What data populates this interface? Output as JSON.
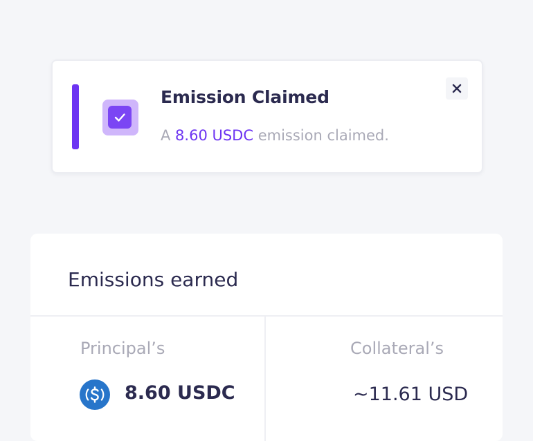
{
  "toast": {
    "title": "Emission Claimed",
    "message_prefix": "A ",
    "message_amount": "8.60 USDC",
    "message_suffix": " emission claimed.",
    "close_symbol": "×",
    "icon": "check-icon",
    "accent_color": "#6d34f2"
  },
  "emissions": {
    "title": "Emissions earned",
    "principal": {
      "label": "Principal’s",
      "value": "8.60 USDC",
      "icon": "usdc-icon"
    },
    "collateral": {
      "label": "Collateral’s",
      "value": "~11.61 USD"
    }
  },
  "colors": {
    "brand": "#6d34f2",
    "text_dark": "#2b2a4f",
    "text_muted": "#a9a9b6",
    "usdc": "#2775ca"
  }
}
